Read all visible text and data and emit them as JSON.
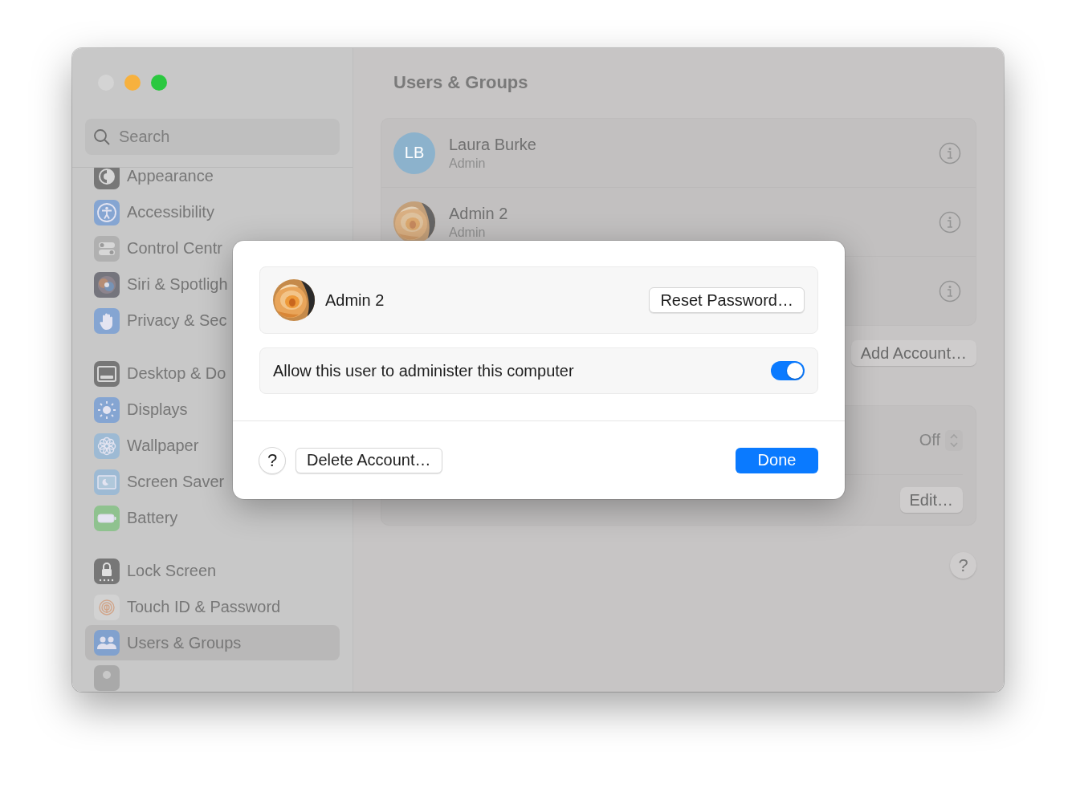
{
  "sidebar": {
    "search": {
      "placeholder": "Search"
    },
    "groups": [
      {
        "items": [
          {
            "label": "Appearance",
            "selected": false
          },
          {
            "label": "Accessibility",
            "selected": false
          },
          {
            "label": "Control Centr",
            "selected": false
          },
          {
            "label": "Siri & Spotligh",
            "selected": false
          },
          {
            "label": "Privacy & Sec",
            "selected": false
          }
        ]
      },
      {
        "items": [
          {
            "label": "Desktop & Do",
            "selected": false
          },
          {
            "label": "Displays",
            "selected": false
          },
          {
            "label": "Wallpaper",
            "selected": false
          },
          {
            "label": "Screen Saver",
            "selected": false
          },
          {
            "label": "Battery",
            "selected": false
          }
        ]
      },
      {
        "items": [
          {
            "label": "Lock Screen",
            "selected": false
          },
          {
            "label": "Touch ID & Password",
            "selected": false
          },
          {
            "label": "Users & Groups",
            "selected": true
          }
        ]
      }
    ]
  },
  "main": {
    "title": "Users & Groups",
    "users": [
      {
        "kind": "initials",
        "initials": "LB",
        "name": "Laura Burke",
        "role": "Admin"
      },
      {
        "kind": "picture",
        "name": "Admin 2",
        "role": "Admin"
      },
      {
        "kind": "covered"
      }
    ],
    "add_account_button": "Add Account…",
    "settings": [
      {
        "kind": "stepper",
        "value": "Off"
      },
      {
        "kind": "button",
        "button": "Edit…"
      }
    ],
    "help_button": "?"
  },
  "dialog": {
    "user": {
      "name": "Admin 2"
    },
    "reset_button": "Reset Password…",
    "admin_toggle": {
      "label": "Allow this user to administer this computer",
      "on": true
    },
    "help_button": "?",
    "delete_button": "Delete Account…",
    "done_button": "Done"
  }
}
